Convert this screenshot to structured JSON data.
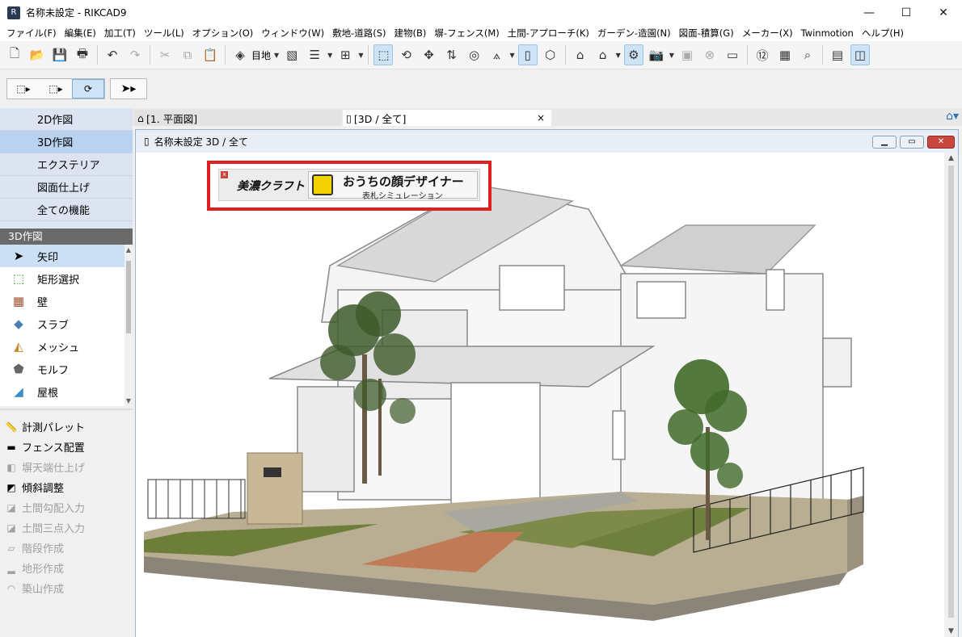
{
  "window": {
    "title": "名称未設定 - RIKCAD9",
    "minimize": "—",
    "maximize": "☐",
    "close": "✕"
  },
  "menu": [
    "ファイル(F)",
    "編集(E)",
    "加工(T)",
    "ツール(L)",
    "オプション(O)",
    "ウィンドウ(W)",
    "敷地-道路(S)",
    "建物(B)",
    "塀-フェンス(M)",
    "土間-アプローチ(K)",
    "ガーデン-造園(N)",
    "図面-積算(G)",
    "メーカー(X)",
    "Twinmotion",
    "ヘルプ(H)"
  ],
  "toolbar": {
    "layer_label": "目地"
  },
  "nav": {
    "items": [
      "2D作図",
      "3D作図",
      "エクステリア",
      "図面仕上げ",
      "全ての機能"
    ],
    "active_index": 1,
    "section_title": "3D作図"
  },
  "tools": [
    {
      "icon": "arrow-icon",
      "label": "矢印",
      "active": true
    },
    {
      "icon": "marquee-icon",
      "label": "矩形選択"
    },
    {
      "icon": "wall-icon",
      "label": "壁"
    },
    {
      "icon": "slab-icon",
      "label": "スラブ"
    },
    {
      "icon": "mesh-icon",
      "label": "メッシュ"
    },
    {
      "icon": "morph-icon",
      "label": "モルフ"
    },
    {
      "icon": "roof-icon",
      "label": "屋根"
    }
  ],
  "lower_tools": [
    {
      "label": "計測パレット",
      "enabled": true
    },
    {
      "label": "フェンス配置",
      "enabled": true
    },
    {
      "label": "塀天端仕上げ",
      "enabled": false
    },
    {
      "label": "傾斜調整",
      "enabled": true
    },
    {
      "label": "土間勾配入力",
      "enabled": false
    },
    {
      "label": "土間三点入力",
      "enabled": false
    },
    {
      "label": "階段作成",
      "enabled": false
    },
    {
      "label": "地形作成",
      "enabled": false
    },
    {
      "label": "築山作成",
      "enabled": false
    }
  ],
  "tabs": {
    "plan": "[1. 平面図]",
    "view3d": "[3D / 全て]",
    "close": "×"
  },
  "inner_window": {
    "title": "名称未設定 3D / 全て"
  },
  "banner": {
    "brand": "美濃クラフト",
    "title": "おうちの顔デザイナー",
    "subtitle": "表札シミュレーション",
    "close": "x"
  },
  "colors": {
    "accent_blue": "#cfe3f7",
    "banner_border": "#e02020",
    "section_head": "#6a6a6a"
  }
}
